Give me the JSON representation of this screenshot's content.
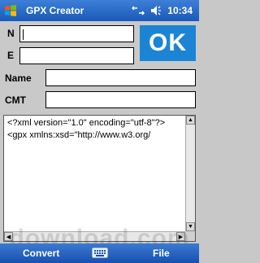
{
  "titlebar": {
    "title": "GPX Creator",
    "clock": "10:34"
  },
  "form": {
    "n_label": "N",
    "e_label": "E",
    "name_label": "Name",
    "cmt_label": "CMT",
    "n_value": "",
    "e_value": "",
    "name_value": "",
    "cmt_value": "",
    "ok_label": "OK"
  },
  "xml": {
    "line1": "<?xml version=\"1.0\" encoding=\"utf-8\"?>",
    "line2": "<gpx xmlns:xsd=\"http://www.w3.org/"
  },
  "menubar": {
    "left": "Convert",
    "right": "File"
  },
  "watermark": "download.com"
}
